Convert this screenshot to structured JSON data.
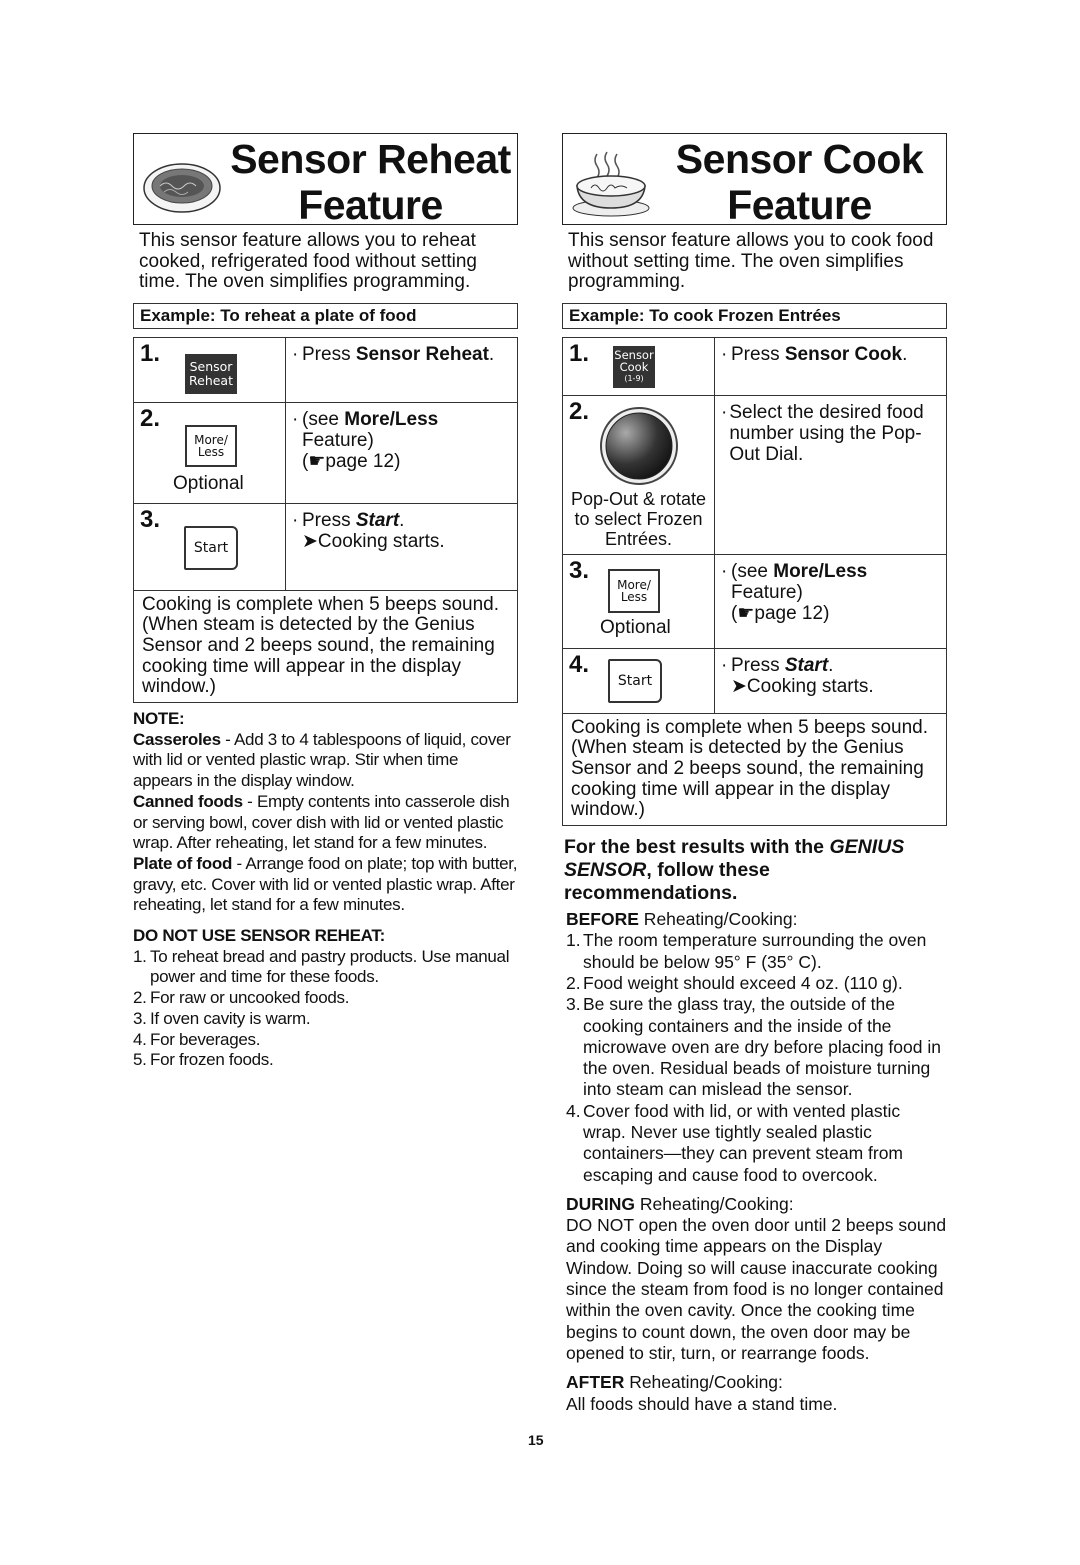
{
  "page_number": "15",
  "left": {
    "title_line1": "Sensor Reheat",
    "title_line2": "Feature",
    "image": "plate-of-food-icon",
    "intro": "This sensor feature allows you to reheat cooked, refrigerated food without setting time. The oven simplifies programming.",
    "example": "Example: To reheat a plate of food",
    "steps": [
      {
        "num": "1.",
        "button": "Sensor Reheat",
        "button_line1": "Sensor",
        "button_line2": "Reheat",
        "text_prefix": "Press ",
        "text_bold": "Sensor Reheat",
        "text_suffix": "."
      },
      {
        "num": "2.",
        "button_line1": "More/",
        "button_line2": "Less",
        "caption": "Optional",
        "text_prefix": "(see ",
        "text_bold": "More/Less",
        "text_line2": "Feature)",
        "text_line3_ref": "page 12",
        "pointer": "☛"
      },
      {
        "num": "3.",
        "button": "Start",
        "text_prefix": "Press ",
        "text_bold_italic": "Start",
        "text_suffix": ".",
        "result": "Cooking starts.",
        "arrow": "➤"
      }
    ],
    "complete_text": "Cooking is complete when 5 beeps sound. (When steam is detected by the Genius Sensor and 2 beeps sound, the remaining cooking time will appear in the display window.)",
    "note": {
      "heading": "NOTE:",
      "items": [
        {
          "label": "Casseroles",
          "text": " - Add 3 to 4 tablespoons of liquid, cover with lid or vented plastic wrap. Stir when time appears in the display window."
        },
        {
          "label": "Canned foods",
          "text": " - Empty contents into casserole dish or serving bowl, cover dish with lid or vented plastic wrap. After reheating, let stand for a few minutes."
        },
        {
          "label": "Plate of food",
          "text": " - Arrange food on plate; top with butter, gravy, etc. Cover with lid or vented plastic wrap. After reheating, let stand for a few minutes."
        }
      ]
    },
    "do_not_use": {
      "heading": "DO NOT USE SENSOR REHEAT:",
      "items": [
        {
          "n": "1.",
          "text": "To reheat bread and pastry products. Use manual power and time for these foods."
        },
        {
          "n": "2.",
          "text": "For raw or uncooked foods."
        },
        {
          "n": "3.",
          "text": "If oven cavity is warm."
        },
        {
          "n": "4.",
          "text": "For beverages."
        },
        {
          "n": "5.",
          "text": "For frozen foods."
        }
      ]
    }
  },
  "right": {
    "title_line1": "Sensor Cook",
    "title_line2": "Feature",
    "image": "soup-bowl-icon",
    "intro": "This sensor feature allows you to cook food without setting time. The oven simplifies programming.",
    "example": "Example: To cook Frozen Entrées",
    "steps": [
      {
        "num": "1.",
        "button_line1": "Sensor",
        "button_line2": "Cook",
        "button_line3": "(1-9)",
        "text_prefix": "Press ",
        "text_bold": "Sensor Cook",
        "text_suffix": "."
      },
      {
        "num": "2.",
        "control": "pop-out-dial",
        "caption": "Pop-Out & rotate to select Frozen Entrées.",
        "text": "Select the desired food number using the Pop-Out Dial."
      },
      {
        "num": "3.",
        "button_line1": "More/",
        "button_line2": "Less",
        "caption": "Optional",
        "text_prefix": "(see ",
        "text_bold": "More/Less",
        "text_line2": "Feature)",
        "text_line3_ref": "page 12",
        "pointer": "☛"
      },
      {
        "num": "4.",
        "button": "Start",
        "text_prefix": "Press ",
        "text_bold_italic": "Start",
        "text_suffix": ".",
        "result": "Cooking starts.",
        "arrow": "➤"
      }
    ],
    "complete_text": "Cooking is complete when 5 beeps sound. (When steam is detected by the Genius Sensor and 2 beeps sound, the remaining cooking time will appear in the display window.)",
    "recommendations": {
      "heading_prefix": "For the best results with the ",
      "heading_italic": "GENIUS SENSOR",
      "heading_suffix": ", follow these recommendations.",
      "before_label": "BEFORE",
      "before_rest": " Reheating/Cooking:",
      "before_items": [
        {
          "n": "1.",
          "text": "The room temperature surrounding the oven should be below 95° F (35° C)."
        },
        {
          "n": "2.",
          "text": "Food weight should exceed 4 oz. (110 g)."
        },
        {
          "n": "3.",
          "text": "Be sure the glass tray, the outside of the cooking containers and the inside of the microwave oven are dry before placing food in the oven. Residual beads of moisture turning into steam can mislead the sensor."
        },
        {
          "n": "4.",
          "text": "Cover food with lid, or with vented plastic wrap. Never use tightly sealed plastic containers—they can prevent steam from escaping and cause food to overcook."
        }
      ],
      "during_label": "DURING",
      "during_rest": " Reheating/Cooking:",
      "during_text": "DO NOT open the oven door until 2 beeps sound and cooking time appears on the Display Window.  Doing so will cause inaccurate cooking since the steam from food is no longer contained within the oven cavity. Once the cooking time begins to count down, the oven door may be opened to stir, turn, or rearrange foods.",
      "after_label": "AFTER",
      "after_rest": " Reheating/Cooking:",
      "after_text": "All foods should have a stand time."
    }
  }
}
